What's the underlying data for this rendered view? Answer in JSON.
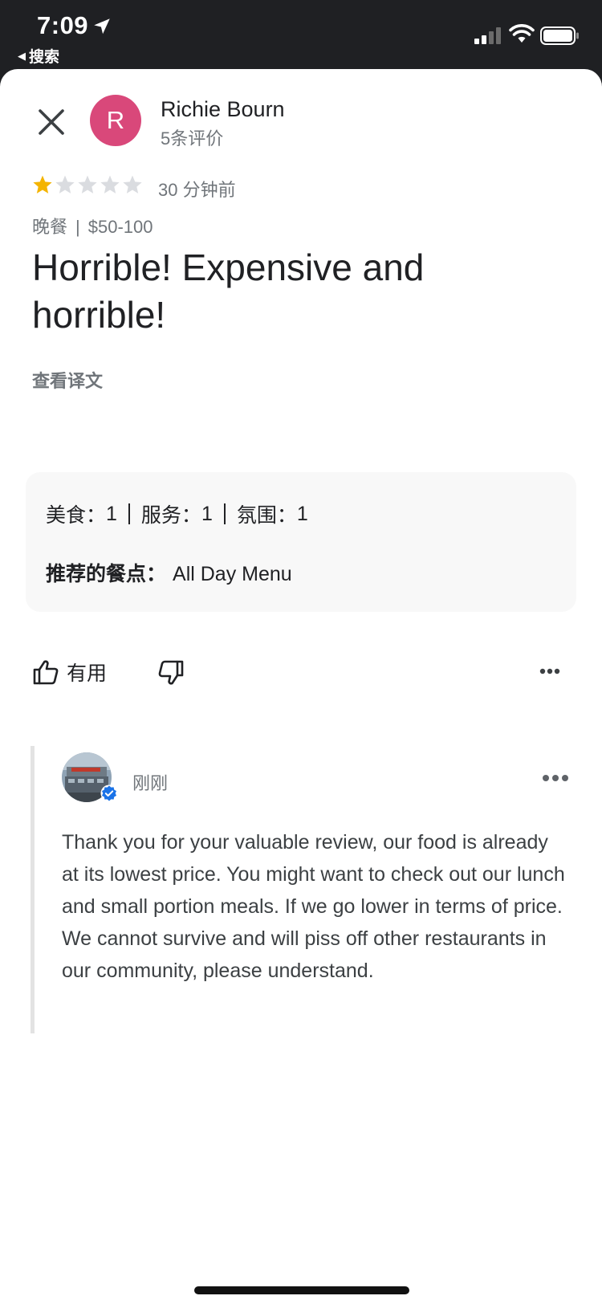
{
  "status_bar": {
    "time": "7:09",
    "back_label": "搜索"
  },
  "reviewer": {
    "avatar_letter": "R",
    "avatar_color": "#d9487a",
    "name": "Richie Bourn",
    "review_count": "5条评价"
  },
  "review": {
    "rating": 1,
    "max_rating": 5,
    "time_ago": "30 分钟前",
    "meal": "晚餐",
    "price": "$50-100",
    "title": "Horrible! Expensive and horrible!",
    "translate_link": "查看译文"
  },
  "ratings": {
    "food_label": "美食：",
    "food_value": "1",
    "service_label": "服务：",
    "service_value": "1",
    "atmosphere_label": "氛围：",
    "atmosphere_value": "1",
    "recommended_label": "推荐的餐点：",
    "recommended_value": "All Day Menu"
  },
  "actions": {
    "helpful_label": "有用"
  },
  "owner_reply": {
    "time": "刚刚",
    "text": "Thank you for your valuable review, our food is already at its lowest price. You might want to check out our lunch and small portion meals. If we go lower in terms of price. We cannot survive and will piss off other restaurants in our community, please understand."
  },
  "colors": {
    "star_filled": "#f4b400",
    "star_empty": "#dadce0",
    "verified": "#1a73e8"
  }
}
